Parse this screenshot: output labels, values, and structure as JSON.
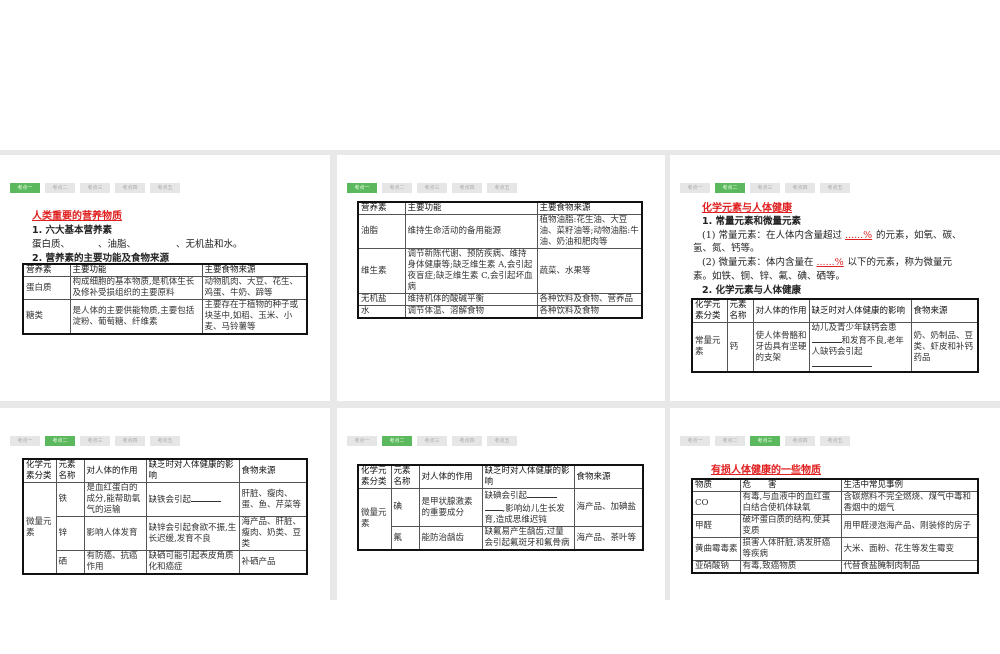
{
  "tabs": [
    "考点一",
    "考点二",
    "考点三",
    "考点四",
    "考点五"
  ],
  "s1": {
    "title": "人类重要的营养物质",
    "h1": "1. 六大基本营养素",
    "line1a": "蛋白质、",
    "line1b": "、油脂、",
    "line1c": "、无机盐和水。",
    "h2": "2. 营养素的主要功能及食物来源",
    "headers": [
      "营养素",
      "主要功能",
      "主要食物来源"
    ],
    "rows": [
      [
        "蛋白质",
        "构成细胞的基本物质,是机体生长及修补受损组织的主要原料",
        "动物肌肉、大豆、花生、鸡蛋、牛奶、蹄等"
      ],
      [
        "糖类",
        "是人体的主要供能物质,主要包括淀粉、葡萄糖、纤维素",
        "主要存在于植物的种子或块茎中,如稻、玉米、小麦、马铃薯等"
      ]
    ]
  },
  "s2": {
    "headers": [
      "营养素",
      "主要功能",
      "主要食物来源"
    ],
    "rows": [
      [
        "油脂",
        "维持生命活动的备用能源",
        "植物油脂:花生油、大豆油、菜籽油等;动物油脂:牛油、奶油和肥肉等"
      ],
      [
        "维生素",
        "调节新陈代谢、预防疾病、维持身体健康等;缺乏维生素 A,会引起夜盲症;缺乏维生素 C,会引起坏血病",
        "蔬菜、水果等"
      ],
      [
        "无机盐",
        "维持机体的酸碱平衡",
        "各种饮料及食物、营养品"
      ],
      [
        "水",
        "调节体温、溶解食物",
        "各种饮料及食物"
      ]
    ]
  },
  "s3": {
    "title": "化学元素与人体健康",
    "h1": "1. 常量元素和微量元素",
    "p1a": "(1) 常量元素：在人体内含量超过",
    "p1blank": "......%",
    "p1b": "的元素，如氧、碳、",
    "p1c": "氢、氮、钙等。",
    "p2a": "(2) 微量元素：体内含量在",
    "p2blank": "......%",
    "p2b": "以下的元素，称为微量元",
    "p2c": "素。如铁、铜、锌、氟、碘、硒等。",
    "h2": "2. 化学元素与人体健康",
    "headers": [
      "化学元素分类",
      "元素名称",
      "对人体的作用",
      "缺乏时对人体健康的影响",
      "食物来源"
    ],
    "row": {
      "cat": "常量元素",
      "name": "钙",
      "role": "使人体骨骼和牙齿具有坚硬的支架",
      "effect_a": "幼儿及青少年缺钙会患",
      "effect_b": "和发育不良,老年人缺钙会引起",
      "source": "奶、奶制品、豆类、虾皮和补钙药品"
    }
  },
  "s4": {
    "headers": [
      "化学元素分类",
      "元素名称",
      "对人体的作用",
      "缺乏时对人体健康的影响",
      "食物来源"
    ],
    "cat": "微量元素",
    "rows": [
      [
        "铁",
        "是血红蛋白的成分,能帮助氧气的运输",
        "缺铁会引起",
        "肝脏、瘦肉、蛋、鱼、芹菜等"
      ],
      [
        "锌",
        "影响人体发育",
        "缺锌会引起食欲不振,生长迟缓,发育不良",
        "海产品、肝脏、瘦肉、奶类、豆类"
      ],
      [
        "硒",
        "有防癌、抗癌作用",
        "缺硒可能引起表皮角质化和癌症",
        "补硒产品"
      ]
    ]
  },
  "s5": {
    "headers": [
      "化学元素分类",
      "元素名称",
      "对人体的作用",
      "缺乏时对人体健康的影响",
      "食物来源"
    ],
    "cat": "微量元素",
    "rows": [
      [
        "碘",
        "是甲状腺激素的重要成分",
        "缺碘会引起",
        "海产品、加碘盐"
      ],
      [
        "氟",
        "能防治龋齿",
        "缺氟易产生龋齿,过量会引起氟斑牙和氟骨病",
        "海产品、茶叶等"
      ]
    ],
    "iodine_b": ",影响幼儿生长发育,造成思维迟钝"
  },
  "s6": {
    "title": "有损人体健康的一些物质",
    "headers": [
      "物质",
      "危　　害",
      "生活中常见事例"
    ],
    "rows": [
      [
        "CO",
        "有毒,与血液中的血红蛋白结合使机体缺氧",
        "含碳燃料不完全燃烧、煤气中毒和香烟中的烟气"
      ],
      [
        "甲醛",
        "破坏蛋白质的结构,使其变质",
        "用甲醛浸泡海产品、刚装修的房子"
      ],
      [
        "黄曲霉毒素",
        "损害人体肝脏,诱发肝癌等疾病",
        "大米、面粉、花生等发生霉变"
      ],
      [
        "亚硝酸钠",
        "有毒,致癌物质",
        "代替食盐腌制肉制品"
      ]
    ]
  }
}
